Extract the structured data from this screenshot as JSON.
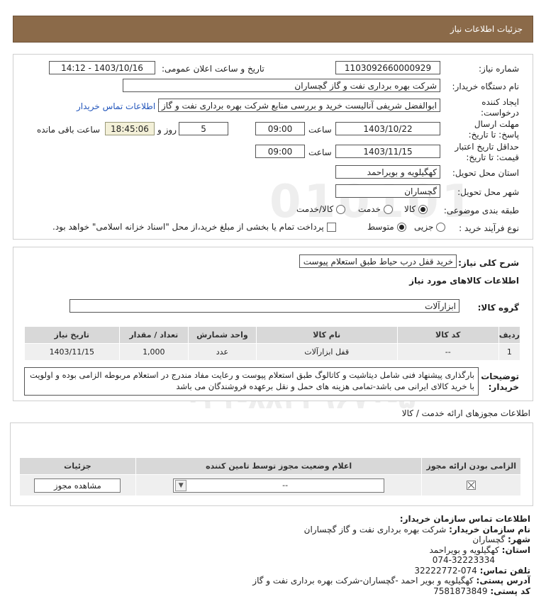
{
  "header": {
    "title": "جزئیات اطلاعات نیاز"
  },
  "form": {
    "need_number_label": "شماره نیاز:",
    "need_number": "1103092660000929",
    "announce_label": "تاریخ و ساعت اعلان عمومی:",
    "announce_value": "1403/10/16 - 14:12",
    "buyer_label": "نام دستگاه خریدار:",
    "buyer_value": "شرکت بهره برداری نفت و گاز گچساران",
    "creator_label": "ایجاد کننده درخواست:",
    "creator_value": "ابوالفضل شریفی آنالیست خرید و بررسی منابع شرکت بهره برداری نفت و گاز گچساران",
    "contact_link": "اطلاعات تماس خریدار",
    "deadline_label": "مهلت ارسال پاسخ: تا تاریخ:",
    "deadline_date": "1403/10/22",
    "time_label": "ساعت",
    "deadline_time": "09:00",
    "days_value": "5",
    "days_label": "روز و",
    "remain_value": "18:45:06",
    "remain_label": "ساعت باقی مانده",
    "validity_label": "حداقل تاریخ اعتبار قیمت: تا تاریخ:",
    "validity_date": "1403/11/15",
    "validity_time": "09:00",
    "province_label": "استان محل تحویل:",
    "province_value": "کهگیلویه و بویراحمد",
    "city_label": "شهر محل تحویل:",
    "city_value": "گچساران",
    "category_label": "طبقه بندی موضوعی:",
    "category_options": [
      "کالا",
      "خدمت",
      "کالا/خدمت"
    ],
    "category_selected": "کالا",
    "process_label": "نوع فرآیند خرید :",
    "process_options": [
      "جزیی",
      "متوسط"
    ],
    "process_selected": "متوسط",
    "payment_note": "پرداخت تمام یا بخشی از مبلغ خرید،از محل \"اسناد خزانه اسلامی\" خواهد بود."
  },
  "details": {
    "summary_label": "شرح کلی نیاز:",
    "summary_value": "خرید قفل درب حیاط طبق استعلام پیوست",
    "goods_title": "اطلاعات کالاهای مورد نیاز",
    "group_label": "گروه کالا:",
    "group_value": "ابزارآلات",
    "table": {
      "headers": [
        "ردیف",
        "کد کالا",
        "نام کالا",
        "واحد شمارش",
        "تعداد / مقدار",
        "تاریخ نیاز"
      ],
      "rows": [
        [
          "1",
          "--",
          "قفل ابزارآلات",
          "عدد",
          "1,000",
          "1403/11/15"
        ]
      ]
    },
    "buyer_notes_label": "توضیحات خریدار:",
    "buyer_notes": "بارگذاری پیشنهاد فنی شامل دیتاشیت و کاتالوگ طبق استعلام پیوست و رعایت مفاد مندرج در استعلام مربوطه الزامی بوده و اولویت با خرید کالای ایرانی می باشد-تمامی هزینه های حمل و نقل برعهده فروشندگان می باشد"
  },
  "permits": {
    "title": "اطلاعات مجوزهای ارائه خدمت / کالا",
    "headers": [
      "الزامی بودن ارائه مجوز",
      "اعلام وضعیت مجوز توسط تامین کننده",
      "جزئیات"
    ],
    "status_value": "--",
    "view_button": "مشاهده مجوز"
  },
  "contact": {
    "title": "اطلاعات تماس سازمان خریدار:",
    "org_label": "نام سازمان خریدار:",
    "org_value": "شرکت بهره برداری نفت و گاز گچساران",
    "city_label": "شهر:",
    "city_value": "گچساران",
    "province_label": "استان:",
    "province_value": "کهگیلویه و بویراحمد",
    "fax_value": "074-32223334",
    "phone_label": "تلفن تماس:",
    "phone_value": "074-32222772",
    "address_label": "آدرس پستی:",
    "address_value": "کهگیلویه و بویر احمد -گچساران-شرکت بهره برداری نفت و گاز",
    "postal_label": "کد پستی:",
    "postal_value": "7581873849"
  },
  "watermark": {
    "brand": "ParsNamadData",
    "tagline": "مرکز فرآوری اطلاعات پارس نماد داده",
    "phone": "۰۲۱-۸۸۳۴۹۶۷۰-۵",
    "number": "010101"
  }
}
